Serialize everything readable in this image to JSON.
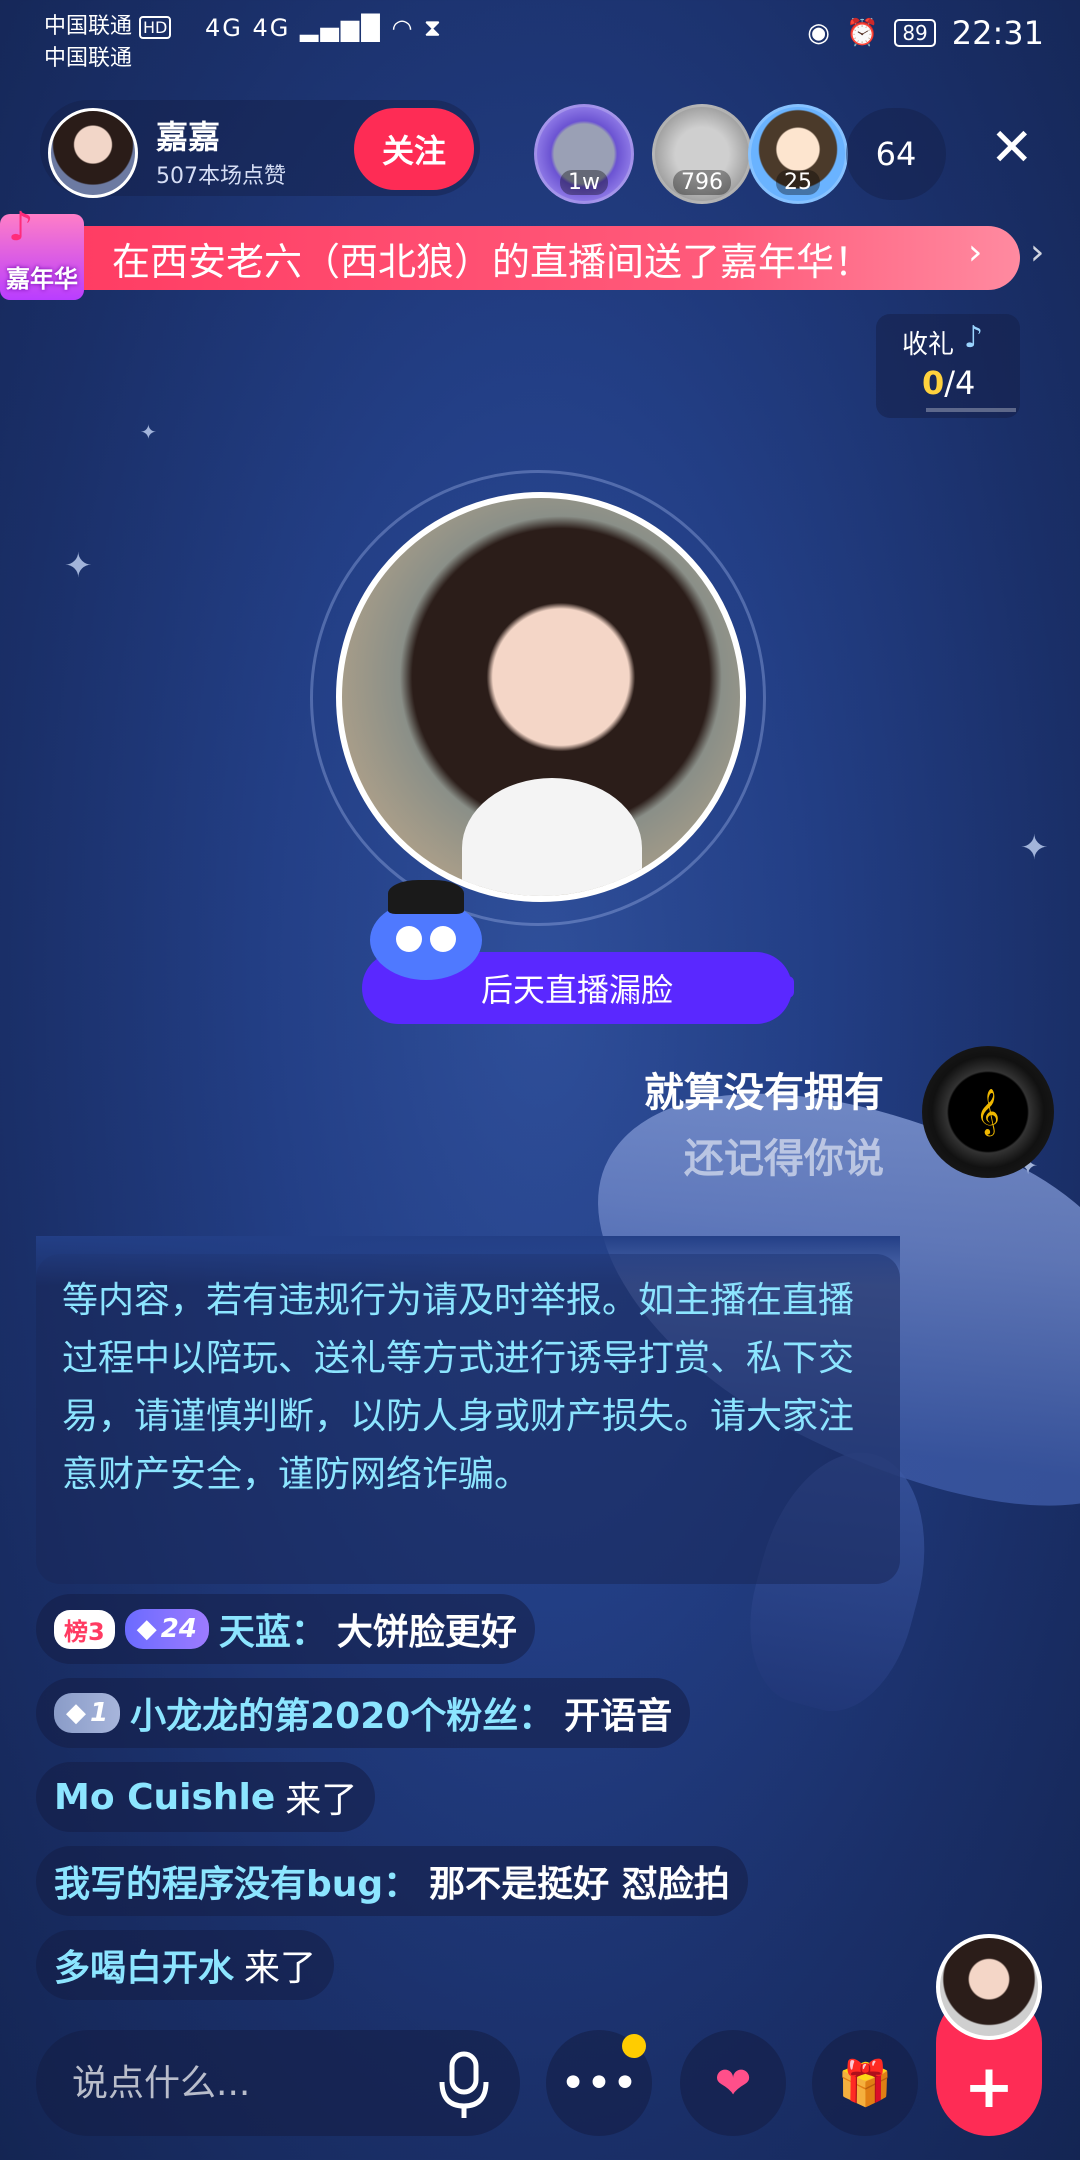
{
  "status_bar": {
    "carrier_1": "中国联通",
    "carrier_1_hd": "HD",
    "carrier_2": "中国联通",
    "signal": "4G 4G",
    "battery": "89",
    "time": "22:31"
  },
  "host": {
    "name": "嘉嘉",
    "likes": "507本场点赞",
    "follow_label": "关注"
  },
  "viewers": {
    "top_badges": [
      "1w",
      "796",
      "25"
    ],
    "count": "64"
  },
  "banner": {
    "badge_label": "嘉年华",
    "text": "在西安老六（西北狼）的直播间送了嘉年华！"
  },
  "gift_box": {
    "title": "收礼",
    "current": "0",
    "total": "/4"
  },
  "topic": {
    "text": "后天直播漏脸"
  },
  "lyrics": {
    "line_1": "就算没有拥有",
    "line_2": "还记得你说"
  },
  "notice": {
    "text": "等内容，若有违规行为请及时举报。如主播在直播过程中以陪玩、送礼等方式进行诱导打赏、私下交易，请谨慎判断，以防人身或财产损失。请大家注意财产安全，谨防网络诈骗。"
  },
  "chat": [
    {
      "rank": "榜3",
      "level": "24",
      "name": "天蓝：",
      "message": "大饼脸更好"
    },
    {
      "level": "1",
      "name": "小龙龙的第2020个粉丝：",
      "message": "开语音"
    },
    {
      "name": "Mo Cuishle",
      "message": "来了"
    },
    {
      "name": "我写的程序没有bug：",
      "message": "那不是挺好 怼脸拍"
    },
    {
      "name": "多喝白开水",
      "message": "来了"
    }
  ],
  "bottom_bar": {
    "input_placeholder": "说点什么...",
    "icons": [
      "mic-icon",
      "more-icon",
      "heart-icon",
      "gift-icon",
      "plus-icon"
    ]
  },
  "colors": {
    "accent": "#fe2c55",
    "topic": "#5a28ff",
    "chat_name": "#8ce5ff"
  }
}
